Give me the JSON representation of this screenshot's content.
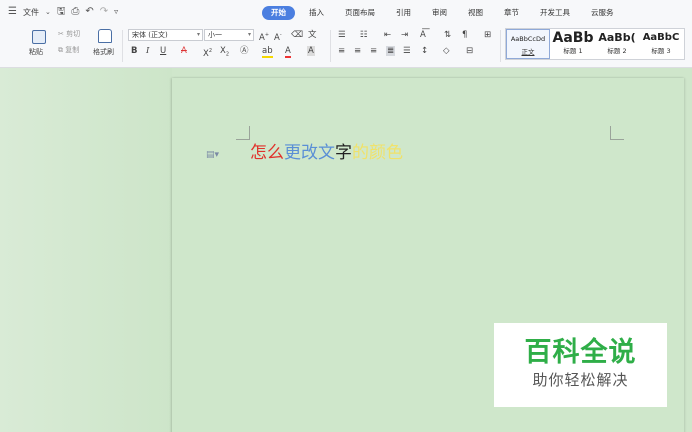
{
  "menubar": {
    "file_label": "文件",
    "tabs": [
      {
        "label": "开始",
        "active": true
      },
      {
        "label": "插入"
      },
      {
        "label": "页面布局"
      },
      {
        "label": "引用"
      },
      {
        "label": "审阅"
      },
      {
        "label": "视图"
      },
      {
        "label": "章节"
      },
      {
        "label": "开发工具"
      },
      {
        "label": "云服务"
      }
    ],
    "accent_color": "#4b7fe0"
  },
  "ribbon": {
    "clipboard": {
      "paste_label": "粘贴",
      "cut_label": "剪切",
      "copy_label": "复制",
      "format_painter_label": "格式刷"
    },
    "font": {
      "font_name": "宋体 (正文)",
      "font_size": "小一"
    },
    "styles": [
      {
        "sample": "AaBbCcDd",
        "name": "正文",
        "selected": true
      },
      {
        "sample": "AaBb",
        "name": "标题 1"
      },
      {
        "sample": "AaBb(",
        "name": "标题 2"
      },
      {
        "sample": "AaBbC",
        "name": "标题 3"
      }
    ]
  },
  "document": {
    "runs": [
      {
        "text": "怎么",
        "color": "#e0322b"
      },
      {
        "text": "更改文",
        "color": "#5a8fd6"
      },
      {
        "text": "字",
        "color": "#222222"
      },
      {
        "text": "的颜色",
        "color": "#f0e26a"
      }
    ]
  },
  "watermark": {
    "title": "百科全说",
    "subtitle": "助你轻松解决"
  }
}
